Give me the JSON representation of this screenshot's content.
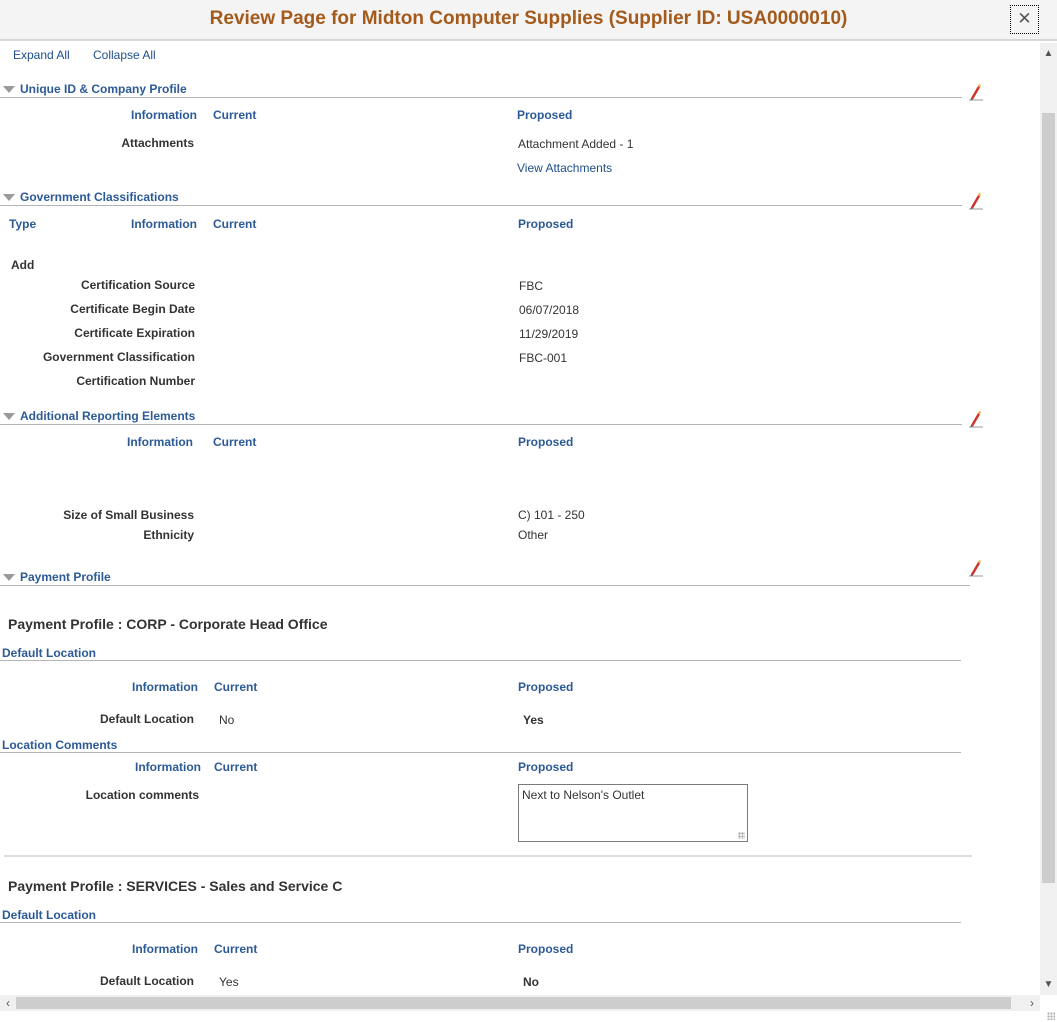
{
  "window": {
    "title": "Review Page for Midton Computer Supplies (Supplier ID: USA0000010)",
    "close_label": "✕"
  },
  "toolbar": {
    "expand_all": "Expand All",
    "collapse_all": "Collapse All"
  },
  "columns": {
    "type": "Type",
    "information": "Information",
    "current": "Current",
    "proposed": "Proposed"
  },
  "sections": {
    "unique_id": {
      "title": "Unique ID & Company Profile",
      "rows": [
        {
          "label": "Attachments",
          "current": "",
          "proposed": "Attachment Added - 1"
        }
      ],
      "view_attachments_link": "View Attachments"
    },
    "gov_class": {
      "title": "Government Classifications",
      "type_value": "Add",
      "rows": [
        {
          "label": "Certification Source",
          "current": "",
          "proposed": "FBC"
        },
        {
          "label": "Certificate Begin Date",
          "current": "",
          "proposed": "06/07/2018"
        },
        {
          "label": "Certificate Expiration",
          "current": "",
          "proposed": "11/29/2019"
        },
        {
          "label": "Government Classification",
          "current": "",
          "proposed": "FBC-001"
        },
        {
          "label": "Certification Number",
          "current": "",
          "proposed": ""
        }
      ]
    },
    "additional_reporting": {
      "title": "Additional Reporting Elements",
      "rows": [
        {
          "label": "Size of Small Business",
          "current": "",
          "proposed": "C) 101 - 250"
        },
        {
          "label": "Ethnicity",
          "current": "",
          "proposed": "Other"
        }
      ]
    },
    "payment_profile": {
      "title": "Payment Profile",
      "profiles": [
        {
          "title": "Payment Profile : CORP - Corporate Head Office",
          "default_location": {
            "subtitle": "Default Location",
            "label": "Default Location",
            "current": "No",
            "proposed": "Yes"
          },
          "location_comments": {
            "subtitle": "Location Comments",
            "label": "Location comments",
            "current": "",
            "proposed": "Next to Nelson's Outlet"
          }
        },
        {
          "title": "Payment Profile : SERVICES - Sales and Service C",
          "default_location": {
            "subtitle": "Default Location",
            "label": "Default Location",
            "current": "Yes",
            "proposed": "No"
          }
        }
      ]
    }
  },
  "colors": {
    "title": "#a35a1b",
    "section_header": "#2c5a97",
    "link": "#1f4e8c"
  }
}
